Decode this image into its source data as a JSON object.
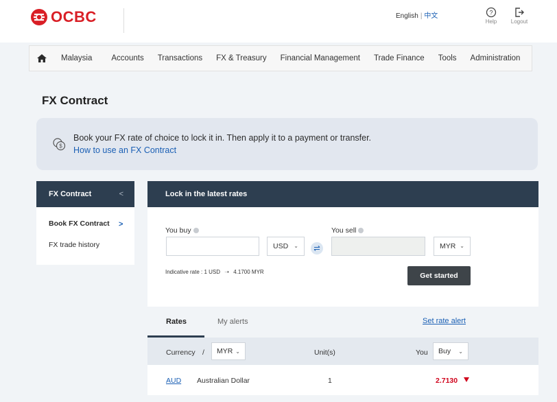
{
  "brand": {
    "name": "OCBC",
    "color": "#d91f26"
  },
  "header": {
    "lang_english": "English",
    "lang_separator": "|",
    "lang_chinese": "中文",
    "help_label": "Help",
    "logout_label": "Logout"
  },
  "nav": {
    "home_icon": "home-icon",
    "items": [
      "Malaysia",
      "Accounts",
      "Transactions",
      "FX & Treasury",
      "Financial Management",
      "Trade Finance",
      "Tools",
      "Administration"
    ]
  },
  "page": {
    "title": "FX Contract"
  },
  "banner": {
    "icon": "currency-exchange-icon",
    "text": "Book your FX rate of choice to lock it in. Then apply it to a payment or transfer.",
    "link": "How to use an FX Contract"
  },
  "sidebar": {
    "title": "FX Contract",
    "items": [
      {
        "label": "Book FX Contract",
        "active": true
      },
      {
        "label": "FX trade history",
        "active": false
      }
    ]
  },
  "lock_panel": {
    "title": "Lock in the latest rates",
    "buy_label": "You buy",
    "buy_value": "",
    "buy_currency": "USD",
    "sell_label": "You sell",
    "sell_value": "",
    "sell_currency": "MYR",
    "indicative_prefix": "Indicative rate : 1 USD",
    "indicative_value": "4.1700 MYR",
    "button": "Get started"
  },
  "rates_tabs": {
    "tabs": [
      "Rates",
      "My alerts"
    ],
    "active_tab": "Rates",
    "set_alert": "Set rate alert"
  },
  "rates_table": {
    "currency_label": "Currency",
    "slash": "/",
    "base_currency": "MYR",
    "units_label": "Unit(s)",
    "you_label": "You",
    "direction": "Buy",
    "rows": [
      {
        "code": "AUD",
        "name": "Australian Dollar",
        "units": "1",
        "rate": "2.7130",
        "trend": "down"
      }
    ]
  },
  "colors": {
    "navy": "#2d3e50",
    "link": "#1a5fb4",
    "down": "#d0021b",
    "page_bg": "#f1f4f7"
  }
}
